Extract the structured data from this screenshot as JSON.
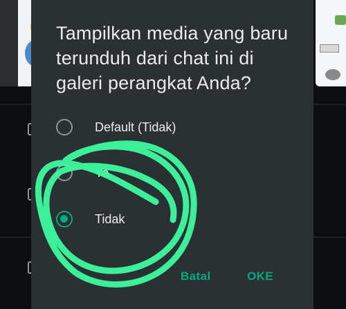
{
  "dialog": {
    "title": "Tampilkan media yang baru terunduh dari chat ini di galeri perangkat Anda?",
    "options": [
      {
        "label": "Default (Tidak)",
        "selected": false
      },
      {
        "label": "Ya",
        "selected": false
      },
      {
        "label": "Tidak",
        "selected": true
      }
    ],
    "cancel_label": "Batal",
    "ok_label": "OKE"
  },
  "colors": {
    "dialog_bg": "#2b3033",
    "accent": "#00a884",
    "text": "#e9edef",
    "scribble": "#3dfba0"
  }
}
